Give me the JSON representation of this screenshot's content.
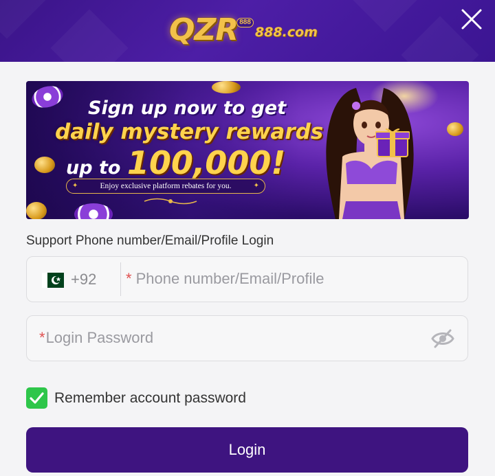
{
  "brand": {
    "logo_main": "QZR",
    "logo_badge": "888",
    "logo_domain": "888.com"
  },
  "banner": {
    "line1": "Sign up now to get",
    "line2": "daily mystery rewards",
    "line3_prefix": "up to",
    "line3_amount": "100,000!",
    "subtitle": "Enjoy exclusive platform rebates for you."
  },
  "form": {
    "title": "Support Phone number/Email/Profile Login",
    "phone": {
      "country_code": "+92",
      "required_mark": "*",
      "placeholder": "Phone number/Email/Profile"
    },
    "password": {
      "required_mark": "*",
      "placeholder": "Login Password"
    },
    "remember_label": "Remember account password",
    "remember_checked": true,
    "login_button": "Login"
  },
  "icons": {
    "close": "close-icon",
    "flag": "pakistan-flag-icon",
    "eye": "eye-slash-icon",
    "check": "check-icon"
  },
  "colors": {
    "header_bg": "#3a1488",
    "accent_gold": "#f2c14a",
    "button_bg": "#3e1480",
    "checkbox": "#2ec64a",
    "required": "#e05050"
  }
}
